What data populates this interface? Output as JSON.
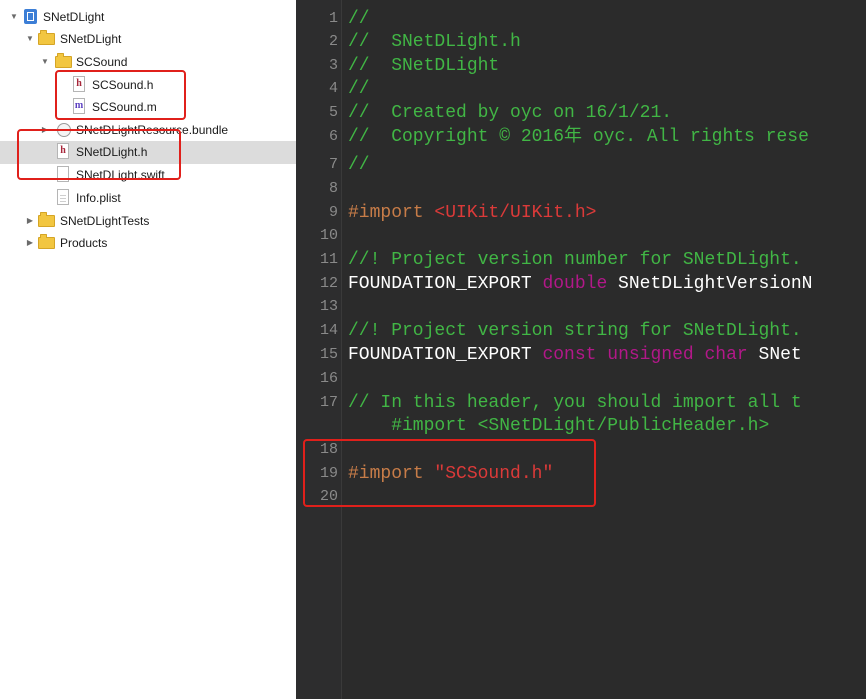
{
  "navigator": {
    "items": [
      {
        "label": "SNetDLight",
        "kind": "project",
        "disclosure": "expanded"
      },
      {
        "label": "SNetDLight",
        "kind": "folder",
        "disclosure": "expanded"
      },
      {
        "label": "SCSound",
        "kind": "folder",
        "disclosure": "expanded"
      },
      {
        "label": "SCSound.h",
        "kind": "header-file",
        "icon_letter": "h"
      },
      {
        "label": "SCSound.m",
        "kind": "implementation-file",
        "icon_letter": "m"
      },
      {
        "label": "SNetDLightResource.bundle",
        "kind": "bundle",
        "disclosure": "collapsed"
      },
      {
        "label": "SNetDLight.h",
        "kind": "header-file",
        "icon_letter": "h",
        "selected": true
      },
      {
        "label": "SNetDLight.swift",
        "kind": "swift-file"
      },
      {
        "label": "Info.plist",
        "kind": "plist-file"
      },
      {
        "label": "SNetDLightTests",
        "kind": "folder",
        "disclosure": "collapsed"
      },
      {
        "label": "Products",
        "kind": "folder",
        "disclosure": "collapsed"
      }
    ],
    "disclosure_glyphs": {
      "expanded": "▼",
      "collapsed": "▶"
    }
  },
  "editor": {
    "lines": [
      {
        "num": "1",
        "segments": [
          {
            "t": "//",
            "c": "comment"
          }
        ]
      },
      {
        "num": "2",
        "segments": [
          {
            "t": "//  SNetDLight.h",
            "c": "comment"
          }
        ]
      },
      {
        "num": "3",
        "segments": [
          {
            "t": "//  SNetDLight",
            "c": "comment"
          }
        ]
      },
      {
        "num": "4",
        "segments": [
          {
            "t": "//",
            "c": "comment"
          }
        ]
      },
      {
        "num": "5",
        "segments": [
          {
            "t": "//  Created by oyc on 16/1/21.",
            "c": "comment"
          }
        ]
      },
      {
        "num": "6",
        "segments": [
          {
            "t": "//  Copyright © 2016年 oyc. All rights rese",
            "c": "comment"
          }
        ]
      },
      {
        "num": "7",
        "segments": [
          {
            "t": "//",
            "c": "comment"
          }
        ]
      },
      {
        "num": "8",
        "segments": []
      },
      {
        "num": "9",
        "segments": [
          {
            "t": "#import ",
            "c": "pre"
          },
          {
            "t": "<UIKit/UIKit.h>",
            "c": "inc"
          }
        ]
      },
      {
        "num": "10",
        "segments": []
      },
      {
        "num": "11",
        "segments": [
          {
            "t": "//! Project version number for SNetDLight.",
            "c": "comment"
          }
        ]
      },
      {
        "num": "12",
        "segments": [
          {
            "t": "FOUNDATION_EXPORT ",
            "c": "plain"
          },
          {
            "t": "double",
            "c": "kw"
          },
          {
            "t": " SNetDLightVersionN",
            "c": "plain"
          }
        ]
      },
      {
        "num": "13",
        "segments": []
      },
      {
        "num": "14",
        "segments": [
          {
            "t": "//! Project version string for SNetDLight.",
            "c": "comment"
          }
        ]
      },
      {
        "num": "15",
        "segments": [
          {
            "t": "FOUNDATION_EXPORT ",
            "c": "plain"
          },
          {
            "t": "const",
            "c": "kw"
          },
          {
            "t": " ",
            "c": "plain"
          },
          {
            "t": "unsigned",
            "c": "kw"
          },
          {
            "t": " ",
            "c": "plain"
          },
          {
            "t": "char",
            "c": "kw"
          },
          {
            "t": " SNet",
            "c": "plain"
          }
        ]
      },
      {
        "num": "16",
        "segments": []
      },
      {
        "num": "17",
        "segments": [
          {
            "t": "// In this header, you should import all t",
            "c": "comment"
          }
        ]
      },
      {
        "num": "",
        "segments": [
          {
            "t": "    #import <SNetDLight/PublicHeader.h>",
            "c": "comment"
          }
        ]
      },
      {
        "num": "18",
        "segments": []
      },
      {
        "num": "19",
        "segments": [
          {
            "t": "#import ",
            "c": "pre"
          },
          {
            "t": "\"SCSound.h\"",
            "c": "str"
          }
        ]
      },
      {
        "num": "20",
        "segments": []
      }
    ]
  },
  "colors": {
    "annotation": "#e0201b",
    "editor_background": "#2b2b2b",
    "comment": "#41b645",
    "keyword": "#b21889",
    "string": "#db3a39",
    "preprocessor": "#c77c48"
  }
}
